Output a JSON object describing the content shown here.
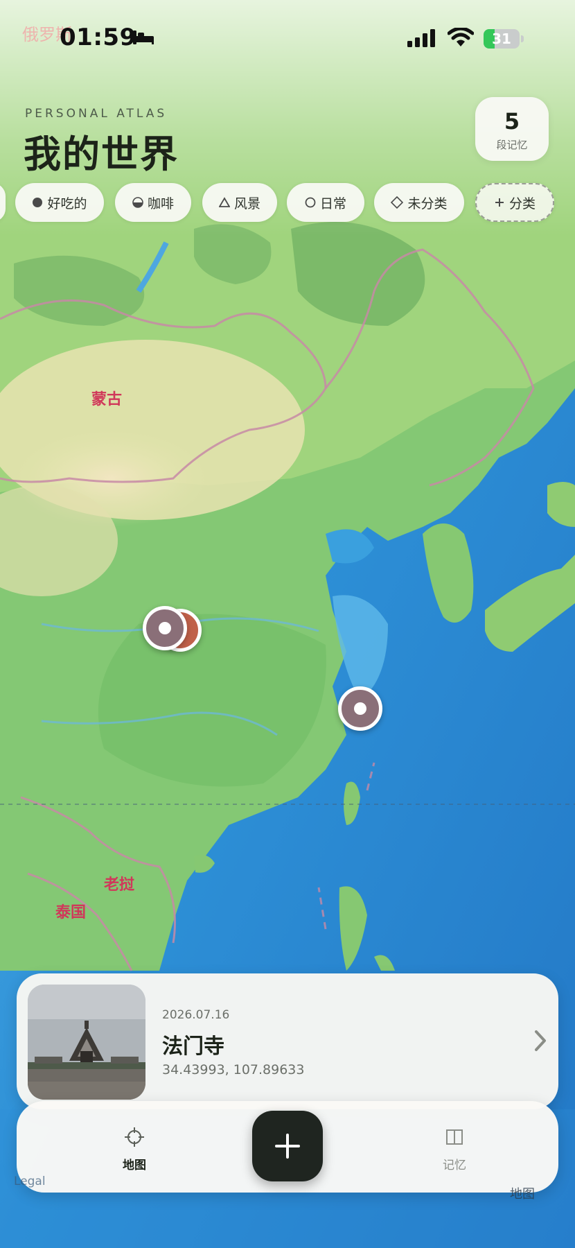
{
  "status_bar": {
    "carrier_hint": "俄罗斯",
    "time": "01:59",
    "focus_icon": "bed-icon",
    "battery_level": "31",
    "battery_fraction": 0.31,
    "icons": [
      "signal-icon",
      "wifi-icon",
      "battery-icon"
    ]
  },
  "header": {
    "eyebrow": "PERSONAL ATLAS",
    "title": "我的世界",
    "count": "5",
    "count_label": "段记忆"
  },
  "categories": [
    {
      "label": "好吃的",
      "icon": "filled-circle-icon",
      "color": "#4a4a4a"
    },
    {
      "label": "咖啡",
      "icon": "half-circle-icon",
      "color": "#4a4a4a"
    },
    {
      "label": "风景",
      "icon": "triangle-icon",
      "color": "#4a4a4a"
    },
    {
      "label": "日常",
      "icon": "circle-icon",
      "color": "#4a4a4a"
    },
    {
      "label": "未分类",
      "icon": "diamond-icon",
      "color": "#4a4a4a"
    },
    {
      "label": "分类",
      "icon": "plus-icon",
      "color": "#4a4a4a"
    }
  ],
  "map": {
    "labels": [
      {
        "text": "蒙古",
        "color": "#d0385a"
      },
      {
        "text": "老挝",
        "color": "#d0385a"
      },
      {
        "text": "泰国",
        "color": "#d0385a"
      }
    ],
    "pins": [
      {
        "name": "memory-pin-back",
        "color": "#c0614a",
        "icon": "map-pin-icon"
      },
      {
        "name": "memory-pin-front",
        "color": "#8a6f78",
        "icon": "map-pin-icon"
      },
      {
        "name": "memory-pin-east",
        "color": "#8a6f78",
        "icon": "map-pin-icon"
      }
    ],
    "legal": "Legal",
    "attribution": "地图"
  },
  "memory_card": {
    "date": "2026.07.16",
    "title": "法门寺",
    "coords": "34.43993, 107.89633",
    "chevron_icon": "chevron-right-icon"
  },
  "tab_bar": {
    "map_label": "地图",
    "map_icon": "crosshair-icon",
    "memory_label": "记忆",
    "memory_icon": "book-icon",
    "add_icon": "plus-icon"
  },
  "colors": {
    "accent_dark": "#1f2520",
    "land_green": "#7cc36a",
    "ocean_blue": "#2f93db",
    "border_pink": "#c78aa6"
  }
}
